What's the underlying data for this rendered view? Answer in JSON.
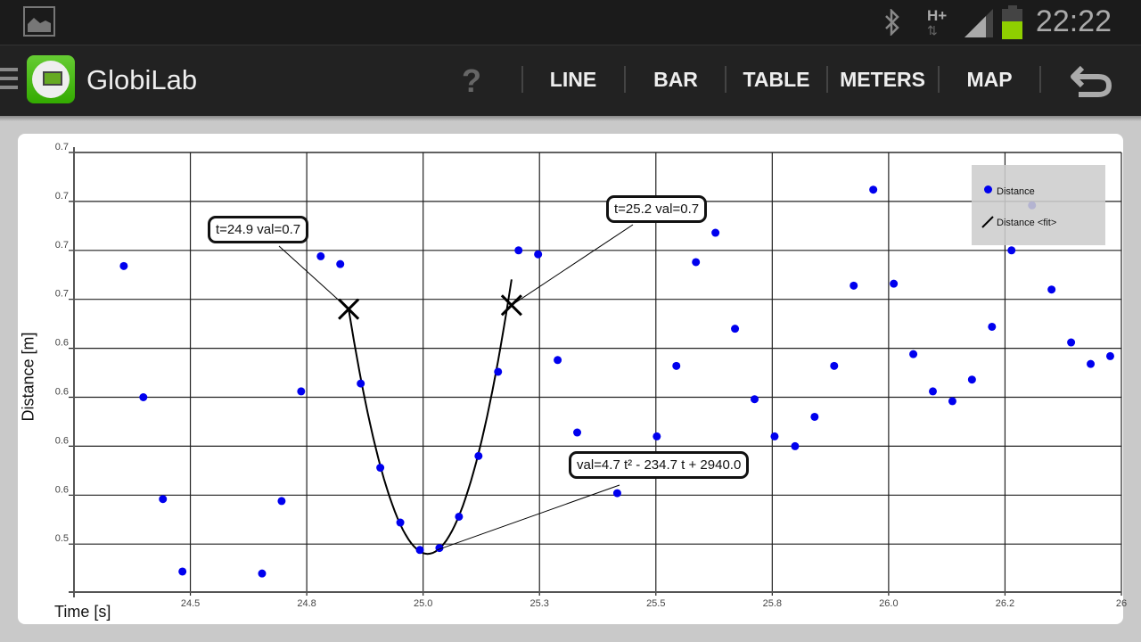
{
  "status_bar": {
    "time": "22:22",
    "network": "H+",
    "icons": [
      "gallery-icon",
      "bluetooth-icon",
      "data-transfer-icon",
      "signal-icon",
      "battery-icon"
    ],
    "battery_color": "#8fcf00"
  },
  "action_bar": {
    "app_title": "GlobiLab",
    "help": "?",
    "tabs": [
      "LINE",
      "BAR",
      "TABLE",
      "METERS",
      "MAP"
    ],
    "back_icon": "undo-icon"
  },
  "chart_data": {
    "type": "scatter",
    "xlabel": "Time [s]",
    "ylabel": "Distance [m]",
    "xlim": [
      24.25,
      26.5
    ],
    "ylim": [
      0.5205,
      0.745
    ],
    "grid": true,
    "x_ticks": [
      24.5,
      24.75,
      25.0,
      25.25,
      25.5,
      25.75,
      26.0,
      26.25,
      26.5
    ],
    "x_tick_labels": [
      "24.5",
      "24.8",
      "25.0",
      "25.3",
      "25.5",
      "25.8",
      "26.0",
      "26.2",
      "26"
    ],
    "y_ticks": [
      0.545,
      0.57,
      0.595,
      0.62,
      0.645,
      0.67,
      0.695,
      0.72,
      0.745
    ],
    "y_tick_labels": [
      "0.5",
      "0.6",
      "0.6",
      "0.6",
      "0.6",
      "0.7",
      "0.7",
      "0.7",
      "0.7"
    ],
    "legend": {
      "placement": "top-right",
      "entries": [
        "Distance",
        "Distance <fit>"
      ]
    },
    "series": [
      {
        "name": "Distance",
        "color": "#0000ee",
        "points": [
          [
            24.357,
            0.687
          ],
          [
            24.399,
            0.62
          ],
          [
            24.441,
            0.568
          ],
          [
            24.483,
            0.531
          ],
          [
            24.654,
            0.53
          ],
          [
            24.696,
            0.567
          ],
          [
            24.738,
            0.623
          ],
          [
            24.78,
            0.692
          ],
          [
            24.822,
            0.688
          ],
          [
            24.866,
            0.627
          ],
          [
            24.908,
            0.584
          ],
          [
            24.951,
            0.556
          ],
          [
            24.993,
            0.542
          ],
          [
            25.035,
            0.543
          ],
          [
            25.077,
            0.559
          ],
          [
            25.119,
            0.59
          ],
          [
            25.161,
            0.633
          ],
          [
            25.205,
            0.695
          ],
          [
            25.247,
            0.693
          ],
          [
            25.289,
            0.639
          ],
          [
            25.331,
            0.602
          ],
          [
            25.417,
            0.571
          ],
          [
            25.502,
            0.6
          ],
          [
            25.544,
            0.636
          ],
          [
            25.586,
            0.689
          ],
          [
            25.628,
            0.704
          ],
          [
            25.67,
            0.655
          ],
          [
            25.712,
            0.619
          ],
          [
            25.755,
            0.6
          ],
          [
            25.799,
            0.595
          ],
          [
            25.841,
            0.61
          ],
          [
            25.883,
            0.636
          ],
          [
            25.925,
            0.677
          ],
          [
            25.967,
            0.726
          ],
          [
            26.011,
            0.678
          ],
          [
            26.053,
            0.642
          ],
          [
            26.095,
            0.623
          ],
          [
            26.137,
            0.618
          ],
          [
            26.179,
            0.629
          ],
          [
            26.222,
            0.656
          ],
          [
            26.264,
            0.695
          ],
          [
            26.308,
            0.718
          ],
          [
            26.35,
            0.675
          ],
          [
            26.392,
            0.648
          ],
          [
            26.434,
            0.637
          ],
          [
            26.476,
            0.641
          ]
        ]
      }
    ],
    "fit": {
      "name": "Distance <fit>",
      "equation": "val=4.7 t² - 234.7 t + 2940.0",
      "t_range": [
        24.84,
        25.19
      ],
      "vertex": [
        25.01,
        0.54
      ]
    },
    "annotations": [
      {
        "text": "t=24.9 val=0.7",
        "t": 24.84,
        "val": 0.665
      },
      {
        "text": "t=25.2 val=0.7",
        "t": 25.19,
        "val": 0.667
      }
    ]
  }
}
